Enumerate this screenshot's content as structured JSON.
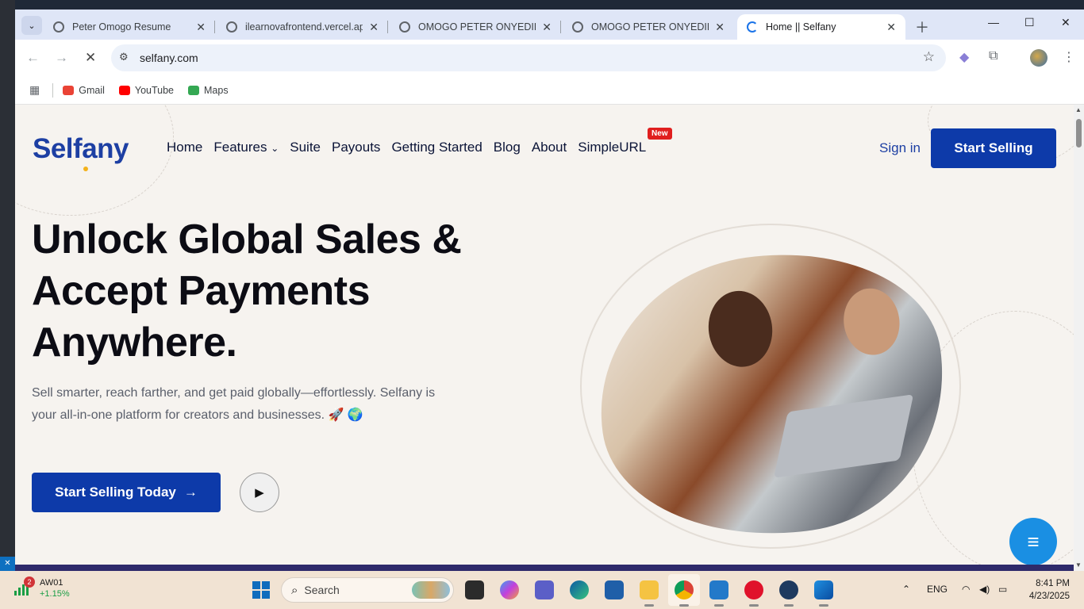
{
  "browser": {
    "tabs": [
      {
        "title": "Peter Omogo Resume"
      },
      {
        "title": "ilearnovafrontend.vercel.app"
      },
      {
        "title": "OMOGO PETER ONYEDIKA |"
      },
      {
        "title": "OMOGO PETER ONYEDIKA |"
      },
      {
        "title": "Home || Selfany"
      }
    ],
    "url": "selfany.com",
    "bookmarks": [
      {
        "label": "Gmail",
        "color": "#ea4335"
      },
      {
        "label": "YouTube",
        "color": "#ff0000"
      },
      {
        "label": "Maps",
        "color": "#34a853"
      }
    ]
  },
  "site": {
    "logo": "Selfany",
    "nav": [
      "Home",
      "Features",
      "Suite",
      "Payouts",
      "Getting Started",
      "Blog",
      "About",
      "SimpleURL"
    ],
    "new_badge": "New",
    "sign_in": "Sign in",
    "start_selling": "Start Selling",
    "hero": {
      "title": "Unlock Global Sales & Accept Payments Anywhere.",
      "subtitle": "Sell smarter, reach farther, and get paid globally—effortlessly. Selfany is your all-in-one platform for creators and businesses. 🚀 🌍",
      "cta": "Start Selling Today"
    },
    "colors": {
      "primary": "#0d3aa9",
      "chat": "#1a8fe3"
    }
  },
  "taskbar": {
    "stock": {
      "name": "AW01",
      "change": "+1.15%",
      "badge": "2"
    },
    "search_label": "Search",
    "language": "ENG",
    "time": "8:41 PM",
    "date": "4/23/2025"
  }
}
